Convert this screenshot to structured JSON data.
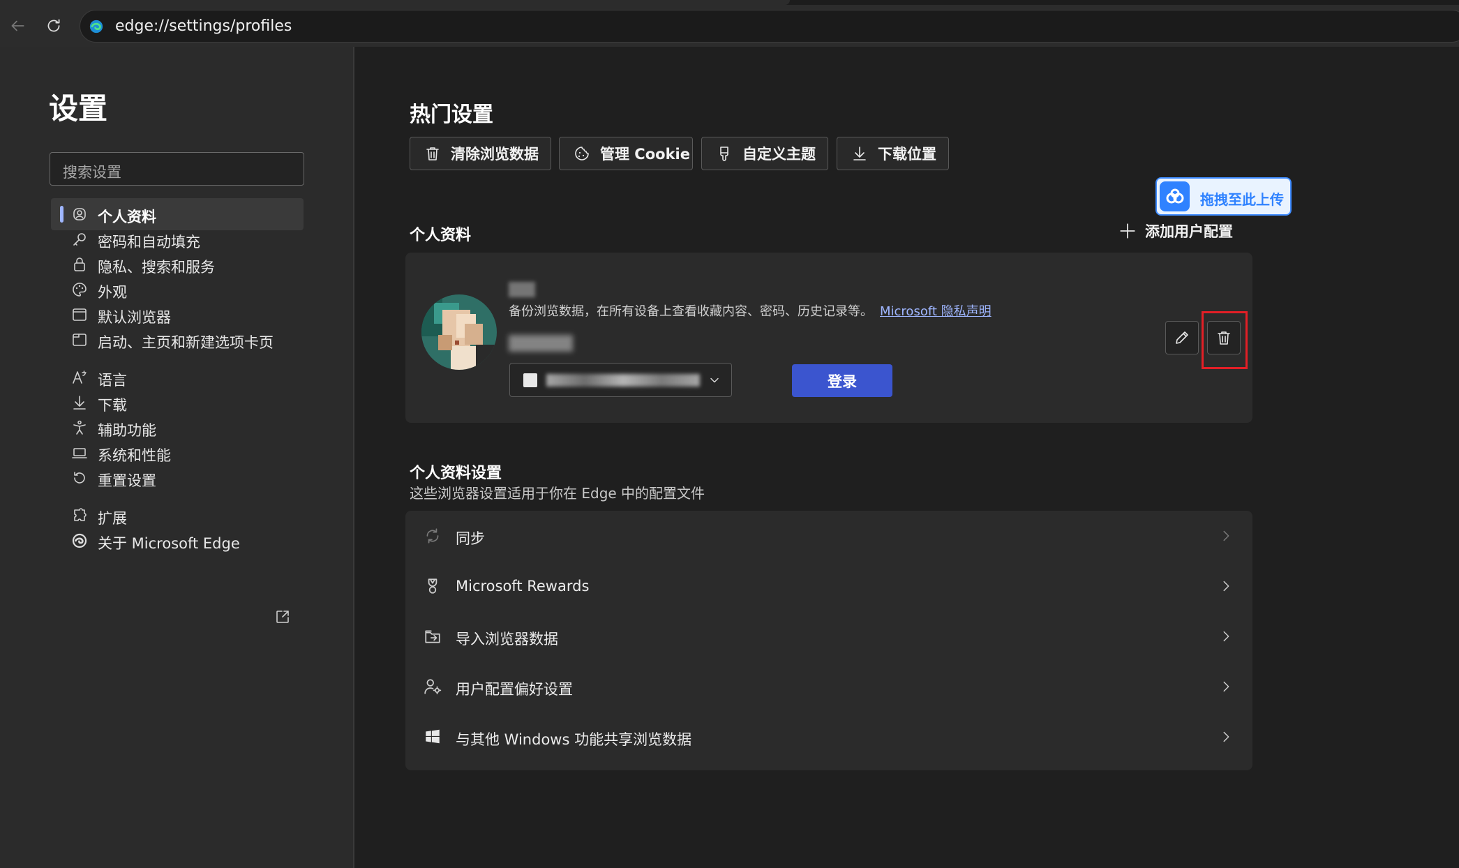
{
  "browser": {
    "url": "edge://settings/profiles"
  },
  "sidebar": {
    "title": "设置",
    "search_placeholder": "搜索设置",
    "items": [
      {
        "label": "个人资料",
        "icon": "profile-icon",
        "active": true
      },
      {
        "label": "密码和自动填充",
        "icon": "key-icon"
      },
      {
        "label": "隐私、搜索和服务",
        "icon": "lock-icon"
      },
      {
        "label": "外观",
        "icon": "palette-icon"
      },
      {
        "label": "默认浏览器",
        "icon": "browser-window-icon"
      },
      {
        "label": "启动、主页和新建选项卡页",
        "icon": "home-tab-icon"
      },
      {
        "label": "语言",
        "icon": "language-icon"
      },
      {
        "label": "下载",
        "icon": "download-icon"
      },
      {
        "label": "辅助功能",
        "icon": "accessibility-icon"
      },
      {
        "label": "系统和性能",
        "icon": "laptop-icon"
      },
      {
        "label": "重置设置",
        "icon": "reset-icon"
      },
      {
        "label": "扩展",
        "icon": "puzzle-icon"
      },
      {
        "label": "关于 Microsoft Edge",
        "icon": "edge-logo-icon"
      }
    ]
  },
  "main": {
    "popular_title": "热门设置",
    "quick_buttons": [
      {
        "label": "清除浏览数据",
        "icon": "trash-icon"
      },
      {
        "label": "管理 Cookie",
        "icon": "cookie-icon"
      },
      {
        "label": "自定义主题",
        "icon": "brush-icon"
      },
      {
        "label": "下载位置",
        "icon": "download-icon"
      }
    ],
    "upload_widget_label": "拖拽至此上传",
    "profile_section_title": "个人资料",
    "add_profile_label": "添加用户配置",
    "profile_card": {
      "description": "备份浏览数据，在所有设备上查看收藏内容、密码、历史记录等。",
      "privacy_link": "Microsoft 隐私声明",
      "signin_label": "登录"
    },
    "settings_section_title": "个人资料设置",
    "settings_section_subtitle": "这些浏览器设置适用于你在 Edge 中的配置文件",
    "settings_rows": [
      {
        "label": "同步",
        "icon": "sync-icon"
      },
      {
        "label": "Microsoft Rewards",
        "icon": "trophy-icon"
      },
      {
        "label": "导入浏览器数据",
        "icon": "import-icon"
      },
      {
        "label": "用户配置偏好设置",
        "icon": "user-settings-icon"
      },
      {
        "label": "与其他 Windows 功能共享浏览数据",
        "icon": "windows-icon"
      }
    ]
  },
  "colors": {
    "accent": "#9fb6ff",
    "signin_button": "#3b55cf",
    "highlight_box": "#e21f26",
    "upload_blue": "#2f82ff"
  }
}
